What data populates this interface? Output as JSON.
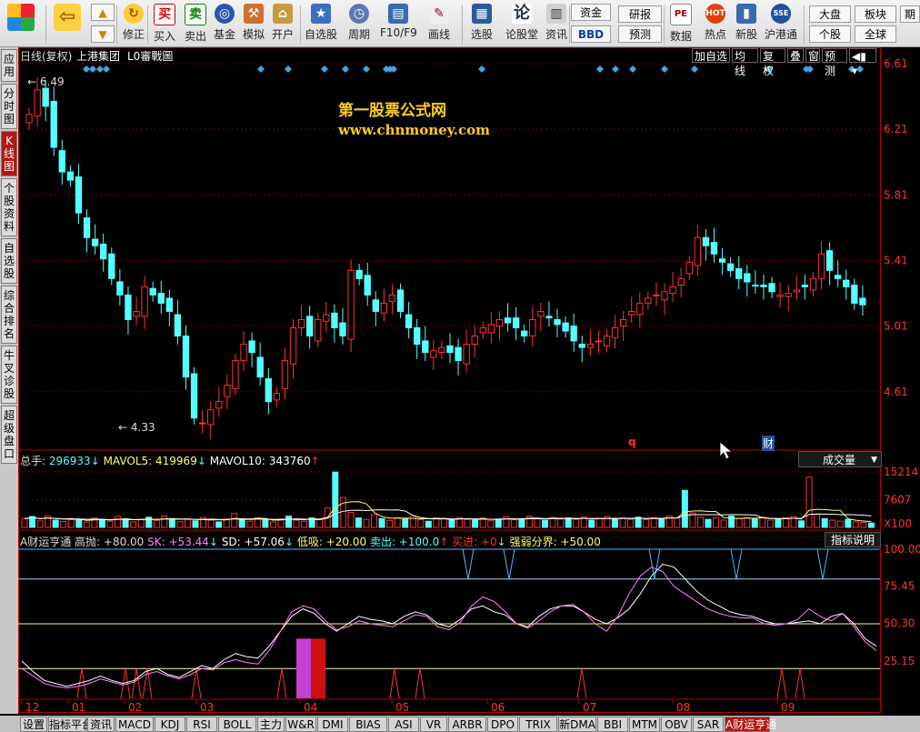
{
  "toolbar": {
    "buttons": [
      {
        "label": "",
        "icon": "logo-icon",
        "x": 2,
        "w": 42
      },
      {
        "label": "",
        "icon": "back-arrow-icon",
        "x": 56,
        "w": 36
      },
      {
        "label": "修正",
        "icon": "refresh-icon",
        "x": 132,
        "w": 30
      },
      {
        "label": "买入",
        "icon": "buy-icon",
        "x": 166,
        "w": 30
      },
      {
        "label": "卖出",
        "icon": "sell-icon",
        "x": 200,
        "w": 30
      },
      {
        "label": "基金",
        "icon": "fund-icon",
        "x": 232,
        "w": 30
      },
      {
        "label": "模拟",
        "icon": "hammer-icon",
        "x": 264,
        "w": 30
      },
      {
        "label": "开户",
        "icon": "lock-icon",
        "x": 296,
        "w": 30
      },
      {
        "label": "自选股",
        "icon": "star-folder-icon",
        "x": 334,
        "w": 38
      },
      {
        "label": "周期",
        "icon": "clock-icon",
        "x": 380,
        "w": 30
      },
      {
        "label": "F10/F9",
        "icon": "f10-icon",
        "x": 418,
        "w": 40
      },
      {
        "label": "画线",
        "icon": "pencil-icon",
        "x": 468,
        "w": 30
      },
      {
        "label": "选股",
        "icon": "screen-icon",
        "x": 512,
        "w": 36
      },
      {
        "label": "论股堂",
        "icon": "lun-icon",
        "x": 556,
        "w": 36
      },
      {
        "label": "资讯",
        "icon": "news-icon",
        "x": 598,
        "w": 28
      },
      {
        "label": "数据",
        "icon": "pe-icon",
        "x": 734,
        "w": 30
      },
      {
        "label": "热点",
        "icon": "hot-icon",
        "x": 772,
        "w": 30
      },
      {
        "label": "新股",
        "icon": "ipo-icon",
        "x": 806,
        "w": 30
      },
      {
        "label": "沪港通",
        "icon": "sse-hkex-icon",
        "x": 840,
        "w": 38
      }
    ],
    "small": {
      "up_label": "↑",
      "zijin": "资金",
      "bbd": "BBD",
      "yanbao": "研报",
      "yuce": "预测",
      "dapan": "大盘",
      "bankuai": "板块",
      "qi": "期",
      "gegu": "个股",
      "quanqiu": "全球"
    }
  },
  "left_tabs": [
    {
      "label": "应用",
      "active": false
    },
    {
      "label": "分时图",
      "active": false
    },
    {
      "label": "K线图",
      "active": true
    },
    {
      "label": "个股资料",
      "active": false
    },
    {
      "label": "自选股",
      "active": false
    },
    {
      "label": "综合排名",
      "active": false
    },
    {
      "label": "牛叉诊股",
      "active": false
    },
    {
      "label": "超级盘口",
      "active": false
    }
  ],
  "chart_header": {
    "period": "日线(复权)",
    "stock": "上港集团",
    "code": "L0審戰圖",
    "buttons": [
      "加自选",
      "均线",
      "复权",
      "叠",
      "窗",
      "预测"
    ]
  },
  "watermark": {
    "title": "第一股票公式网",
    "url": "www.chnmoney.com"
  },
  "price_annotations": {
    "high": "6.49",
    "low": "4.33",
    "marker_q": "q",
    "marker_cai": "财"
  },
  "volume_header": {
    "total_label": "总手:",
    "total_value": "296933",
    "mavol5_label": "MAVOL5:",
    "mavol5_value": "419969",
    "mavol10_label": "MAVOL10:",
    "mavol10_value": "343760",
    "selector": "成交量",
    "unit": "X100"
  },
  "indicator_header": {
    "name": "A财运亨通",
    "gaopao": "高抛: +80.00",
    "sk": "SK: +53.44",
    "sd": "SD: +57.06",
    "dixi": "低吸: +20.00",
    "maichu": "卖出: +100.0",
    "mairu": "买进: +0",
    "qiangruo": "强弱分界: +50.00",
    "help": "指标说明"
  },
  "colors": {
    "up": "#ff3232",
    "down": "#54ffff",
    "grid": "#7a0000",
    "axis": "#b00000"
  },
  "chart_data": [
    {
      "type": "candlestick",
      "y_axis_ticks": [
        "6.61",
        "6.21",
        "5.81",
        "5.41",
        "5.01",
        "4.61"
      ],
      "ylim": [
        4.26,
        6.61
      ],
      "x_labels": [
        "12",
        "01",
        "02",
        "03",
        "04",
        "05",
        "06",
        "07",
        "08",
        "09"
      ],
      "high": 6.49,
      "low": 4.33,
      "closes": [
        6.3,
        6.45,
        6.35,
        6.1,
        5.95,
        5.9,
        5.7,
        5.55,
        5.5,
        5.42,
        5.3,
        5.2,
        5.05,
        5.1,
        5.25,
        5.2,
        5.15,
        5.1,
        4.95,
        4.7,
        4.45,
        4.42,
        4.5,
        4.55,
        4.65,
        4.8,
        4.9,
        4.85,
        4.7,
        4.55,
        4.6,
        4.8,
        5.0,
        5.05,
        4.95,
        5.05,
        5.08,
        5.0,
        4.95,
        5.35,
        5.3,
        5.2,
        5.1,
        5.15,
        5.2,
        5.1,
        5.0,
        4.9,
        4.85,
        4.86,
        4.88,
        4.85,
        4.8,
        4.9,
        4.95,
        5.0,
        5.02,
        5.05,
        5.03,
        5.0,
        4.95,
        5.05,
        5.1,
        5.06,
        5.02,
        4.98,
        4.92,
        4.88,
        4.9,
        4.92,
        4.95,
        5.0,
        5.05,
        5.1,
        5.15,
        5.18,
        5.2,
        5.22,
        5.25,
        5.3,
        5.4,
        5.55,
        5.5,
        5.45,
        5.4,
        5.35,
        5.3,
        5.28,
        5.26,
        5.25,
        5.22,
        5.2,
        5.21,
        5.23,
        5.25,
        5.3,
        5.45,
        5.35,
        5.3,
        5.25,
        5.15,
        5.14
      ]
    },
    {
      "type": "bar",
      "name": "成交量",
      "y_axis_ticks": [
        "15214",
        "7607"
      ],
      "ylim": [
        0,
        16500
      ],
      "values": [
        2400,
        3000,
        1800,
        3200,
        2000,
        1600,
        2500,
        2100,
        1500,
        2600,
        2200,
        1700,
        3000,
        2400,
        1500,
        2200,
        2800,
        1900,
        3100,
        2200,
        1600,
        2400,
        1800,
        2700,
        2000,
        1500,
        2300,
        3800,
        2200,
        1700,
        2600,
        2000,
        1500,
        2300,
        3100,
        2000,
        1700,
        2600,
        2200,
        5400,
        15214,
        8200,
        4100,
        2600,
        2200,
        3500,
        2400,
        1900,
        2700,
        2300,
        3000,
        2100,
        1700,
        2600,
        2400,
        2100,
        2700,
        2200,
        2000,
        2600,
        1800,
        2300,
        2900,
        2100,
        2400,
        3100,
        2500,
        2000,
        2700,
        2300,
        2600,
        2200,
        2800,
        2000,
        2400,
        3000,
        2300,
        2600,
        2200,
        2800,
        2100,
        2700,
        2500,
        3200,
        2600,
        10200,
        4000,
        2800,
        2200,
        2600,
        2000,
        3100,
        2400,
        2700,
        2300,
        2800,
        2000,
        2200,
        2600,
        3000,
        1800,
        13800,
        3600,
        2400,
        2000,
        1700,
        2200,
        1500,
        1400,
        1200
      ]
    },
    {
      "type": "line",
      "name": "A财运亨通",
      "y_axis_ticks": [
        "100.00",
        "75.45",
        "50.30",
        "25.15"
      ],
      "ylim": [
        0,
        100
      ],
      "series": [
        {
          "name": "SK",
          "color": "#ffffff",
          "values": [
            25,
            18,
            12,
            10,
            8,
            10,
            12,
            15,
            12,
            10,
            12,
            18,
            20,
            16,
            14,
            18,
            22,
            20,
            26,
            30,
            28,
            27,
            35,
            45,
            55,
            60,
            57,
            50,
            45,
            50,
            55,
            53,
            52,
            50,
            55,
            58,
            56,
            50,
            48,
            53,
            60,
            62,
            58,
            56,
            50,
            48,
            55,
            60,
            62,
            62,
            58,
            53,
            50,
            54,
            60,
            70,
            82,
            90,
            88,
            80,
            72,
            66,
            62,
            58,
            56,
            55,
            52,
            50,
            50,
            51,
            52,
            50,
            55,
            57,
            50,
            40,
            35
          ]
        },
        {
          "name": "SD",
          "color": "#ff80ff",
          "values": [
            20,
            15,
            10,
            8,
            7,
            8,
            10,
            13,
            11,
            9,
            11,
            16,
            18,
            15,
            13,
            16,
            20,
            19,
            24,
            26,
            24,
            23,
            32,
            45,
            58,
            62,
            60,
            52,
            46,
            48,
            52,
            50,
            49,
            48,
            52,
            56,
            55,
            48,
            46,
            51,
            62,
            68,
            65,
            58,
            50,
            47,
            52,
            58,
            62,
            63,
            58,
            50,
            45,
            55,
            70,
            82,
            88,
            85,
            75,
            70,
            65,
            60,
            57,
            55,
            54,
            54,
            50,
            49,
            50,
            53,
            60,
            55,
            52,
            57,
            48,
            38,
            32
          ]
        }
      ]
    }
  ],
  "bottom_tabs": [
    {
      "label": "设置",
      "active": false
    },
    {
      "label": "指标平台",
      "active": false
    },
    {
      "label": "资讯",
      "active": false
    },
    {
      "label": "MACD",
      "active": false
    },
    {
      "label": "KDJ",
      "active": false
    },
    {
      "label": "RSI",
      "active": false
    },
    {
      "label": "BOLL",
      "active": false
    },
    {
      "label": "主力",
      "active": false
    },
    {
      "label": "W&R",
      "active": false
    },
    {
      "label": "DMI",
      "active": false
    },
    {
      "label": "BIAS",
      "active": false
    },
    {
      "label": "ASI",
      "active": false
    },
    {
      "label": "VR",
      "active": false
    },
    {
      "label": "ARBR",
      "active": false
    },
    {
      "label": "DPO",
      "active": false
    },
    {
      "label": "TRIX",
      "active": false
    },
    {
      "label": "新DMA",
      "active": false
    },
    {
      "label": "BBI",
      "active": false
    },
    {
      "label": "MTM",
      "active": false
    },
    {
      "label": "OBV",
      "active": false
    },
    {
      "label": "SAR",
      "active": false
    },
    {
      "label": "A财运亨通",
      "active": true
    }
  ]
}
